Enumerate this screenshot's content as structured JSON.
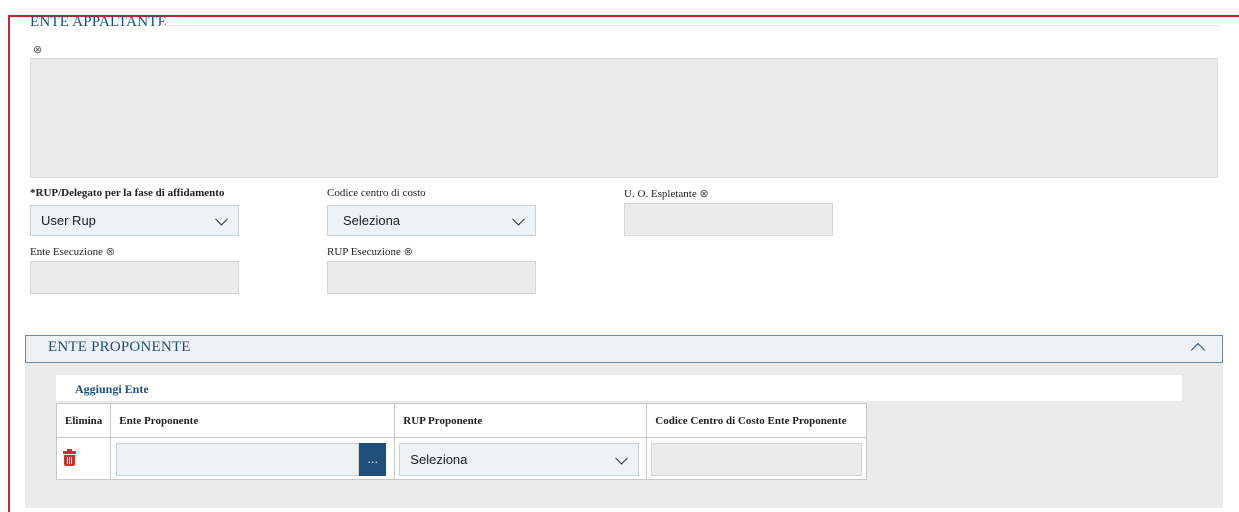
{
  "ente_appaltante": {
    "title": "ENTE APPALTANTE",
    "clear_icon": "⊗",
    "rup_label": "*RUP/Delegato per la fase di affidamento",
    "rup_value": "User Rup",
    "codice_label": "Codice centro di costo",
    "codice_value": "Seleziona",
    "uo_label": "U. O. Espletante",
    "ente_esecuzione_label": "Ente Esecuzione",
    "rup_esecuzione_label": "RUP Esecuzione"
  },
  "ente_proponente": {
    "title": "ENTE PROPONENTE",
    "add_label": "Aggiungi Ente",
    "columns": [
      "Elimina",
      "Ente Proponente",
      "RUP Proponente",
      "Codice Centro di Costo Ente Proponente"
    ],
    "row": {
      "dots_label": "...",
      "rup_value": "Seleziona"
    }
  },
  "colors": {
    "accent": "#1f4e79",
    "frame": "#c0272d",
    "delete": "#d32f2f"
  },
  "icons": [
    "clear-icon",
    "chevron-down-icon",
    "chevron-up-icon",
    "trash-icon"
  ]
}
